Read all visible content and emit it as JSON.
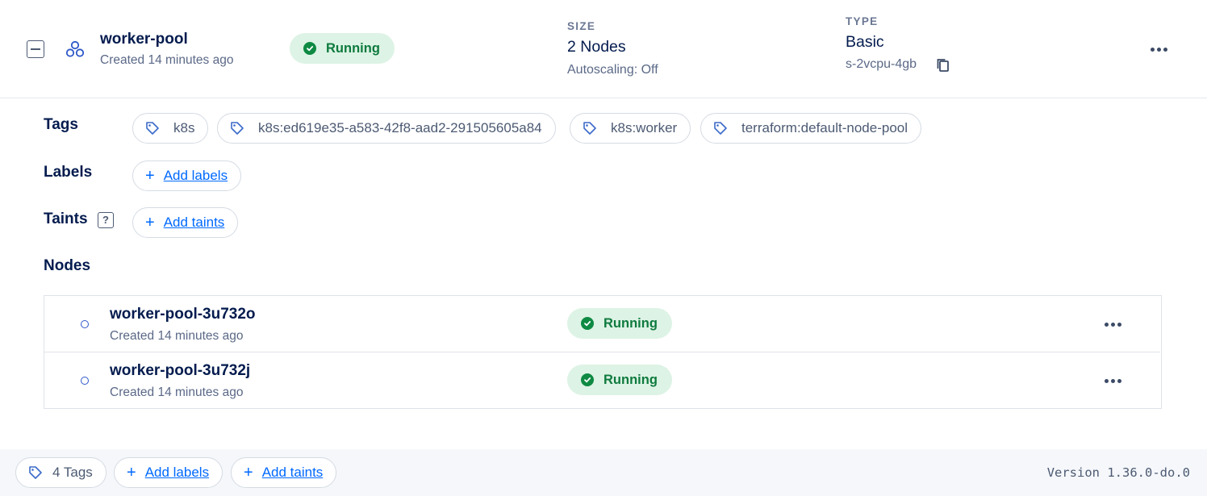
{
  "pool": {
    "name": "worker-pool",
    "created": "Created 14 minutes ago",
    "status": "Running",
    "size_label": "SIZE",
    "size_value": "2 Nodes",
    "autoscaling": "Autoscaling: Off",
    "type_label": "TYPE",
    "type_value": "Basic",
    "droplet_slug": "s-2vcpu-4gb"
  },
  "tags": {
    "label": "Tags",
    "items": [
      "k8s",
      "k8s:ed619e35-a583-42f8-aad2-291505605a84",
      "k8s:worker",
      "terraform:default-node-pool"
    ]
  },
  "labels": {
    "label": "Labels",
    "add": "Add labels"
  },
  "taints": {
    "label": "Taints",
    "help": "?",
    "add": "Add taints"
  },
  "nodes": {
    "label": "Nodes",
    "items": [
      {
        "name": "worker-pool-3u732o",
        "created": "Created 14 minutes ago",
        "status": "Running"
      },
      {
        "name": "worker-pool-3u732j",
        "created": "Created 14 minutes ago",
        "status": "Running"
      }
    ]
  },
  "footer": {
    "tags_count": "4 Tags",
    "add_labels": "Add labels",
    "add_taints": "Add taints",
    "version": "Version 1.36.0-do.0"
  },
  "colors": {
    "primary_link": "#0069ff",
    "running_bg": "#ddf3e5",
    "running_text": "#0e7a3e",
    "text_dark": "#031b4e"
  },
  "icons": [
    "collapse-icon",
    "node-pool-icon",
    "check-circle-icon",
    "copy-icon",
    "more-icon",
    "tag-icon",
    "plus-icon",
    "help-icon",
    "node-status-dot-icon"
  ]
}
